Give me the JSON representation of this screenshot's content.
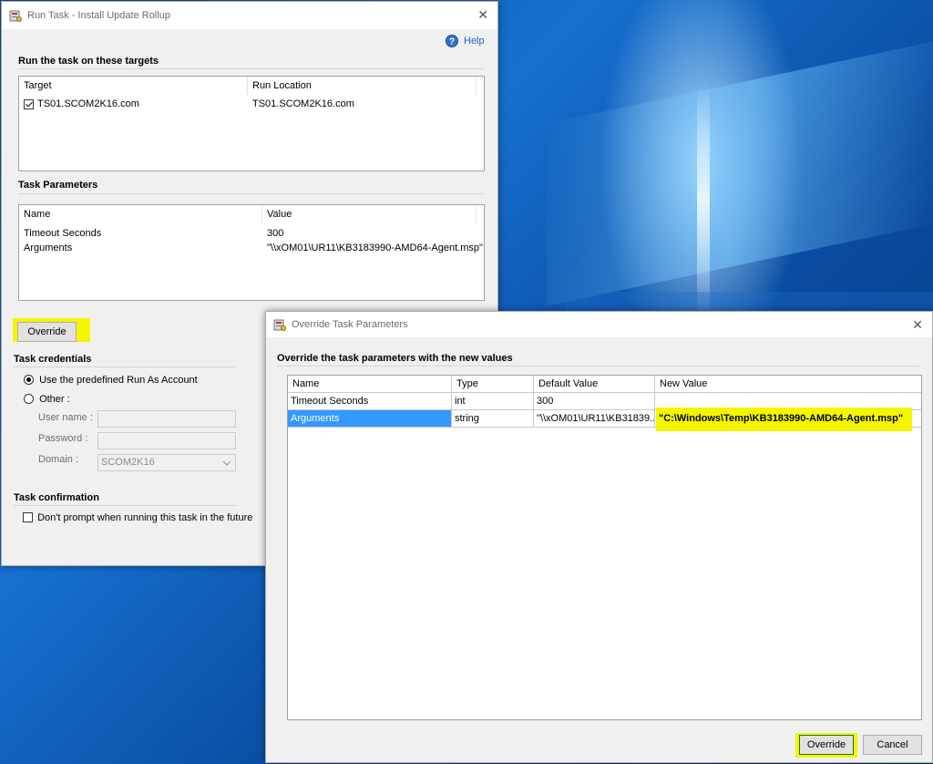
{
  "run_task_window": {
    "title": "Run Task - Install Update Rollup",
    "close_symbol": "✕",
    "help_label": "Help",
    "targets_section_title": "Run the task on these targets",
    "targets_columns": [
      "Target",
      "Run Location"
    ],
    "targets_rows": [
      {
        "checked": true,
        "target": "TS01.SCOM2K16.com",
        "run_location": "TS01.SCOM2K16.com"
      }
    ],
    "params_section_title": "Task Parameters",
    "params_columns": [
      "Name",
      "Value"
    ],
    "params_rows": [
      {
        "name": "Timeout Seconds",
        "value": "300"
      },
      {
        "name": "Arguments",
        "value": "\"\\\\xOM01\\UR11\\KB3183990-AMD64-Agent.msp\""
      }
    ],
    "override_button_label": "Override",
    "credentials_section_title": "Task credentials",
    "radio_predefined_label": "Use the predefined Run As Account",
    "radio_other_label": "Other :",
    "username_label": "User name :",
    "username_value": "",
    "password_label": "Password :",
    "password_value": "",
    "domain_label": "Domain :",
    "domain_value": "SCOM2K16",
    "confirmation_section_title": "Task confirmation",
    "dont_prompt_label": "Don't prompt when running this task in the future",
    "dont_prompt_checked": false
  },
  "override_window": {
    "title": "Override Task Parameters",
    "close_symbol": "✕",
    "section_title": "Override the task parameters with the new values",
    "columns": [
      "Name",
      "Type",
      "Default Value",
      "New Value"
    ],
    "rows": [
      {
        "name": "Timeout Seconds",
        "type": "int",
        "default": "300",
        "new_value": ""
      },
      {
        "name": "Arguments",
        "type": "string",
        "default": "\"\\\\xOM01\\UR11\\KB31839...",
        "new_value": "\"C:\\Windows\\Temp\\KB3183990-AMD64-Agent.msp\""
      }
    ],
    "override_button_label": "Override",
    "cancel_button_label": "Cancel"
  },
  "colors": {
    "highlight": "#f5f500",
    "selection": "#3399ff",
    "desktop_blue": "#0b4fa8"
  },
  "icons": [
    "task-icon",
    "help-icon",
    "close-icon",
    "checkbox-icon",
    "radio-icon",
    "chevron-down-icon"
  ]
}
